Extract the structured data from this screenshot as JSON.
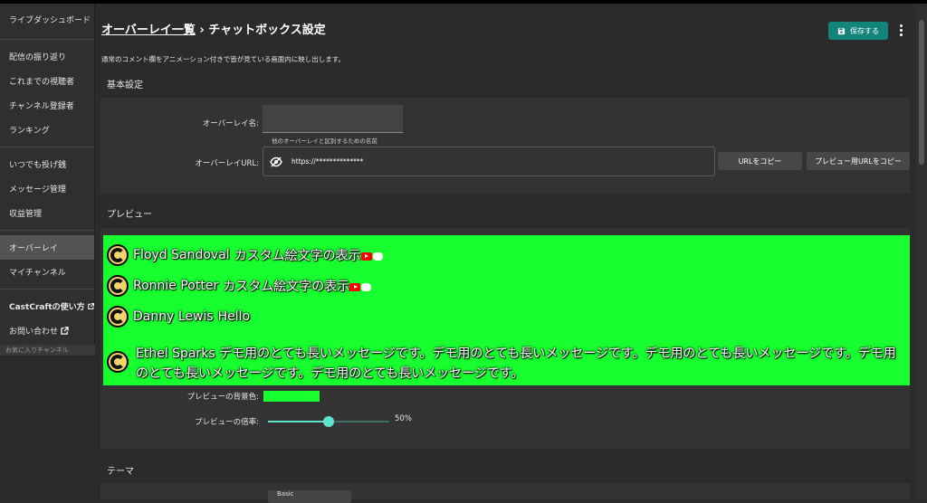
{
  "sidebar": {
    "items": [
      {
        "label": "ライブダッシュボード"
      },
      {
        "label": "配信の振り返り"
      },
      {
        "label": "これまでの視聴者"
      },
      {
        "label": "チャンネル登録者"
      },
      {
        "label": "ランキング"
      },
      {
        "label": "いつでも投げ銭"
      },
      {
        "label": "メッセージ管理"
      },
      {
        "label": "収益管理"
      },
      {
        "label": "オーバーレイ"
      },
      {
        "label": "マイチャンネル"
      },
      {
        "label": "CastCraftの使い方"
      },
      {
        "label": "お問い合わせ"
      }
    ],
    "favorites_label": "お気に入りチャンネル"
  },
  "header": {
    "breadcrumb": "オーバーレイ一覧",
    "separator": "›",
    "title": "チャットボックス設定",
    "save_label": "保存する",
    "description": "通常のコメント欄をアニメーション付きで皆が見ている画面内に映し出します。"
  },
  "basic": {
    "title": "基本設定",
    "name_label": "オーバーレイ名:",
    "name_value": "",
    "name_hint": "他のオーバーレイと区別するための名前",
    "url_label": "オーバーレイURL:",
    "url_value": "https://**************",
    "copy_url": "URLをコピー",
    "copy_preview_url": "プレビュー用URLをコピー"
  },
  "preview": {
    "title": "プレビュー",
    "messages": [
      {
        "author": "Floyd Sandoval",
        "text": "カスタム絵文字の表示"
      },
      {
        "author": "Ronnie Potter",
        "text": "カスタム絵文字の表示"
      },
      {
        "author": "Danny Lewis",
        "text": "Hello"
      },
      {
        "author": "Ethel Sparks",
        "text": "デモ用のとても長いメッセージです。デモ用のとても長いメッセージです。デモ用のとても長いメッセージです。デモ用のとても長いメッセージです。デモ用のとても長いメッセージです。"
      }
    ],
    "bg_label": "プレビューの背景色:",
    "bg_color": "#17ff2f",
    "zoom_label": "プレビューの倍率:",
    "zoom_value": "50%",
    "zoom_fraction": 0.5,
    "accent_color": "#5fe3cf"
  },
  "theme": {
    "title": "テーマ",
    "selected": "Basic"
  }
}
